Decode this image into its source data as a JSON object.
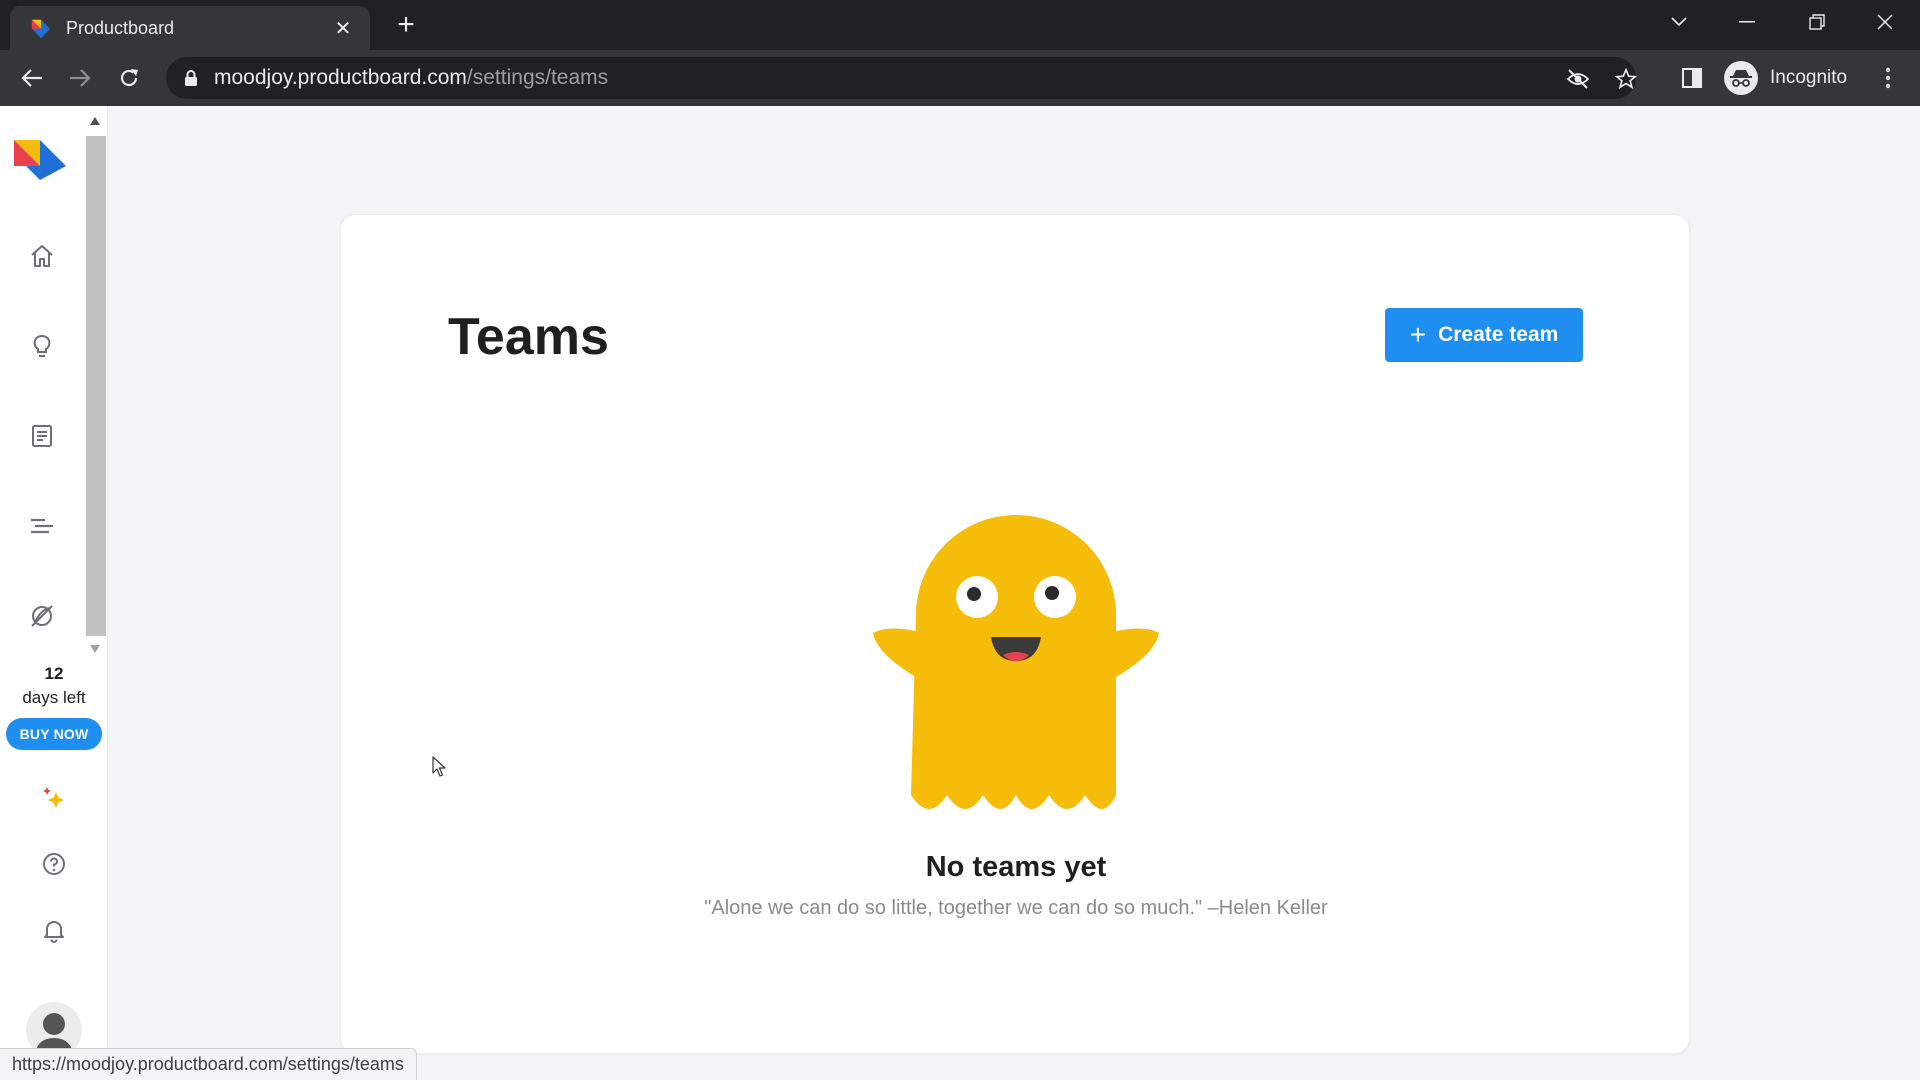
{
  "browser": {
    "tab_title": "Productboard",
    "tab_close": "✕",
    "new_tab": "+",
    "url_host": "moodjoy.productboard.com",
    "url_path": "/settings/teams",
    "profile_label": "Incognito",
    "status_url": "https://moodjoy.productboard.com/settings/teams"
  },
  "sidebar": {
    "nav_icons": [
      "home-icon",
      "lightbulb-icon",
      "notes-icon",
      "roadmap-icon",
      "portal-icon"
    ],
    "trial": {
      "count": "12",
      "label": "days left",
      "buy_label": "BUY NOW"
    },
    "bottom_icons": [
      "sparkle-icon",
      "help-icon",
      "bell-icon"
    ]
  },
  "main": {
    "title": "Teams",
    "create_button": {
      "icon": "+",
      "label": "Create team"
    },
    "empty_state": {
      "title": "No teams yet",
      "quote": "\"Alone we can do so little, together we can do so much.\" –Helen Keller"
    }
  },
  "colors": {
    "accent": "#1f8ef1",
    "ghost": "#f5bd0a",
    "chrome_dark": "#202124",
    "chrome_toolbar": "#35363a"
  }
}
